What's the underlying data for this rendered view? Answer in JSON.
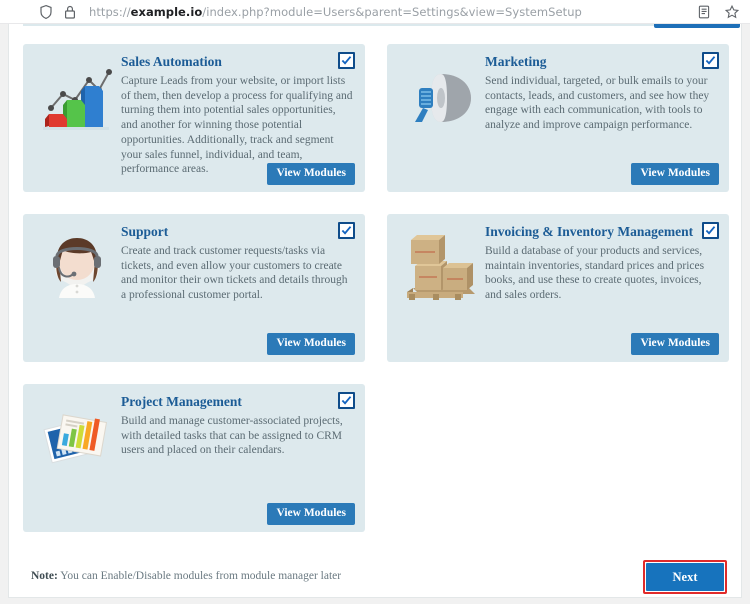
{
  "browser": {
    "url_scheme": "https://",
    "url_domain": "example.io",
    "url_path": "/index.php?module=Users&parent=Settings&view=SystemSetup",
    "shield_icon": "shield-icon",
    "lock_icon": "lock-icon",
    "reader_icon": "reader-view-icon",
    "bookmark_icon": "bookmark-star-icon"
  },
  "colors": {
    "card_bg": "#dde9ed",
    "title_blue": "#1c5c96",
    "button_blue": "#2b7ab8",
    "next_blue": "#1773bd",
    "highlight_red": "#e12b2b",
    "body_text": "#5b6b73"
  },
  "modules": [
    {
      "title": "Sales Automation",
      "description": "Capture Leads from your website, or import lists of them, then develop a process for qualifying and turning them into potential sales opportunities, and another for winning those potential opportunities. Additionally, track and segment your sales funnel, individual, and team, performance areas.",
      "icon": "bar-chart-growth-icon",
      "checked": true,
      "checkbox_label": "enable-sales-automation",
      "button_label": "View Modules"
    },
    {
      "title": "Marketing",
      "description": "Send individual, targeted, or bulk emails to your contacts, leads, and customers, and see how they engage with each communication, with tools to analyze and improve campaign performance.",
      "icon": "megaphone-icon",
      "checked": true,
      "checkbox_label": "enable-marketing",
      "button_label": "View Modules"
    },
    {
      "title": "Support",
      "description": "Create and track customer requests/tasks via tickets, and even allow your customers to create and monitor their own tickets and details through a professional customer portal.",
      "icon": "support-agent-headset-icon",
      "checked": true,
      "checkbox_label": "enable-support",
      "button_label": "View Modules"
    },
    {
      "title": "Invoicing & Inventory Management",
      "description": "Build a database of your products and services, maintain inventories, standard prices and prices books, and use these to create quotes, invoices, and sales orders.",
      "icon": "boxes-on-pallet-icon",
      "checked": true,
      "checkbox_label": "enable-invoicing-inventory",
      "button_label": "View Modules"
    },
    {
      "title": "Project Management",
      "description": "Build and manage customer-associated projects, with detailed tasks that can be assigned to CRM users and placed on their calendars.",
      "icon": "project-charts-documents-icon",
      "checked": true,
      "checkbox_label": "enable-project-management",
      "button_label": "View Modules"
    }
  ],
  "footer": {
    "note_prefix": "Note:",
    "note_text": " You can Enable/Disable modules from module manager later",
    "next_label": "Next"
  }
}
